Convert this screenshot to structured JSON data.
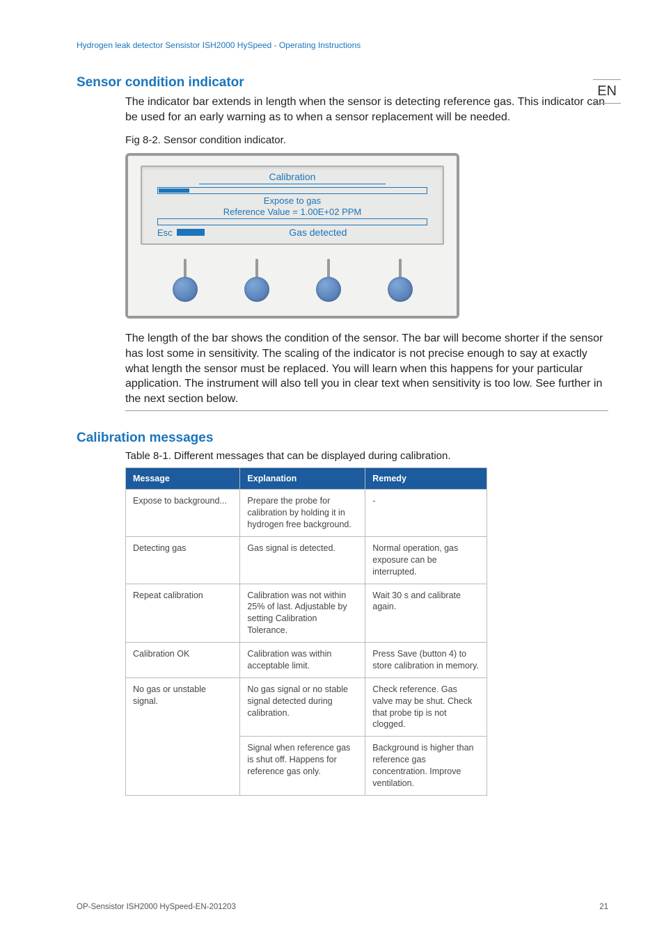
{
  "breadcrumb": {
    "left": "Hydrogen leak detector Sensistor ISH2000 HySpeed",
    "sep": " - ",
    "right": "Operating Instructions"
  },
  "lang": "EN",
  "section1": {
    "title": "Sensor condition indicator",
    "para1": "The indicator bar extends in length when the sensor is detecting reference gas. This indicator can be used for an early warning as to when a sensor replacement will be needed.",
    "figcaption": "Fig 8-2. Sensor condition indicator.",
    "para2": "The length of the bar shows the condition of the sensor. The bar will become shorter if the sensor has lost some in sensitivity. The scaling of the indicator is not precise enough to say at exactly what length the sensor must be replaced. You will learn when this happens for your particular application. The instrument will also tell you in clear text when sensitivity is too low. See further in the next section below."
  },
  "lcd": {
    "title": "Calibration",
    "line1": "Expose to gas",
    "line2": "Reference Value = 1.00E+02 PPM",
    "detected": "Gas detected",
    "esc": "Esc"
  },
  "section2": {
    "title": "Calibration messages",
    "tablecaption": "Table 8-1. Different messages that can be displayed during calibration.",
    "headers": {
      "c1": "Message",
      "c2": "Explanation",
      "c3": "Remedy"
    },
    "rows": [
      {
        "msg": "Expose to background...",
        "expl": "Prepare the probe for calibration by holding it in hydrogen free background.",
        "rem": "-"
      },
      {
        "msg": "Detecting gas",
        "expl": "Gas signal is detected.",
        "rem": "Normal operation, gas exposure can be interrupted."
      },
      {
        "msg": "Repeat calibration",
        "expl": "Calibration was not within 25% of last. Adjustable by setting Calibration Tolerance.",
        "rem": "Wait 30 s and calibrate again."
      },
      {
        "msg": "Calibration OK",
        "expl": "Calibration was within acceptable limit.",
        "rem": "Press Save (button 4) to store calibration in memory."
      },
      {
        "msg": "No gas or unstable signal.",
        "expl": "No gas signal or no stable signal detected during calibration.",
        "rem": "Check reference. Gas valve may be shut. Check that probe tip is not clogged."
      },
      {
        "msg": "",
        "expl": "Signal when reference gas is shut off. Happens for reference gas only.",
        "rem": "Background is higher than reference gas concentration. Improve ventilation."
      }
    ]
  },
  "footer": {
    "left": "OP-Sensistor ISH2000 HySpeed-EN-201203",
    "right": "21"
  }
}
